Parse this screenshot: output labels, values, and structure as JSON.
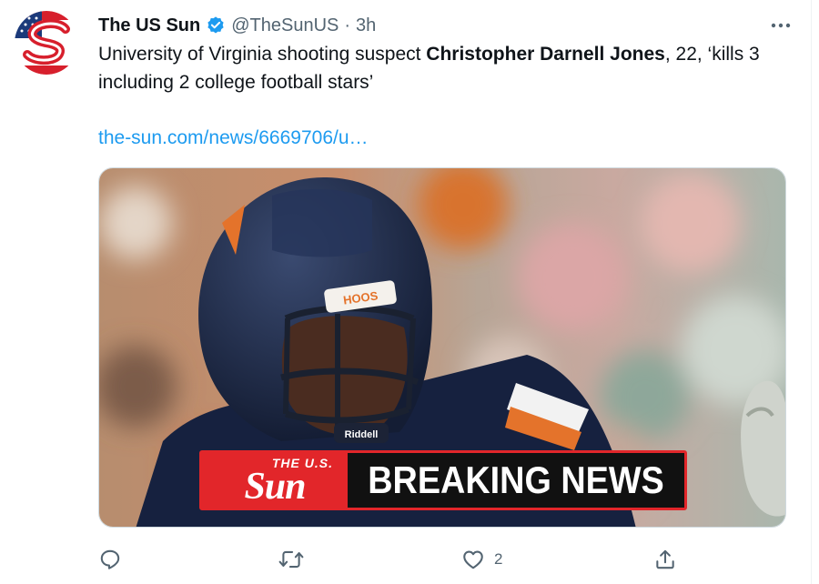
{
  "tweet": {
    "display_name": "The US Sun",
    "handle": "@TheSunUS",
    "separator": "·",
    "timestamp": "3h",
    "text_before": "University of Virginia shooting suspect ",
    "text_bold": "Christopher Darnell Jones",
    "text_after": ", 22, ‘kills 3 including 2 college football stars’",
    "link": "the-sun.com/news/6669706/u…",
    "media": {
      "helmet_logo": "HOOS",
      "chinstrap_text": "Riddell",
      "banner_logo_small": "THE U.S.",
      "banner_logo_big": "Sun",
      "banner_headline": "BREAKING NEWS"
    },
    "actions": {
      "reply_icon": "reply-icon",
      "retweet_icon": "retweet-icon",
      "like_icon": "heart-icon",
      "like_count": "2",
      "share_icon": "share-icon"
    }
  },
  "colors": {
    "link": "#1d9bf0",
    "verified": "#1d9bf0",
    "secondary_text": "#536471",
    "sun_red": "#e2262a"
  }
}
